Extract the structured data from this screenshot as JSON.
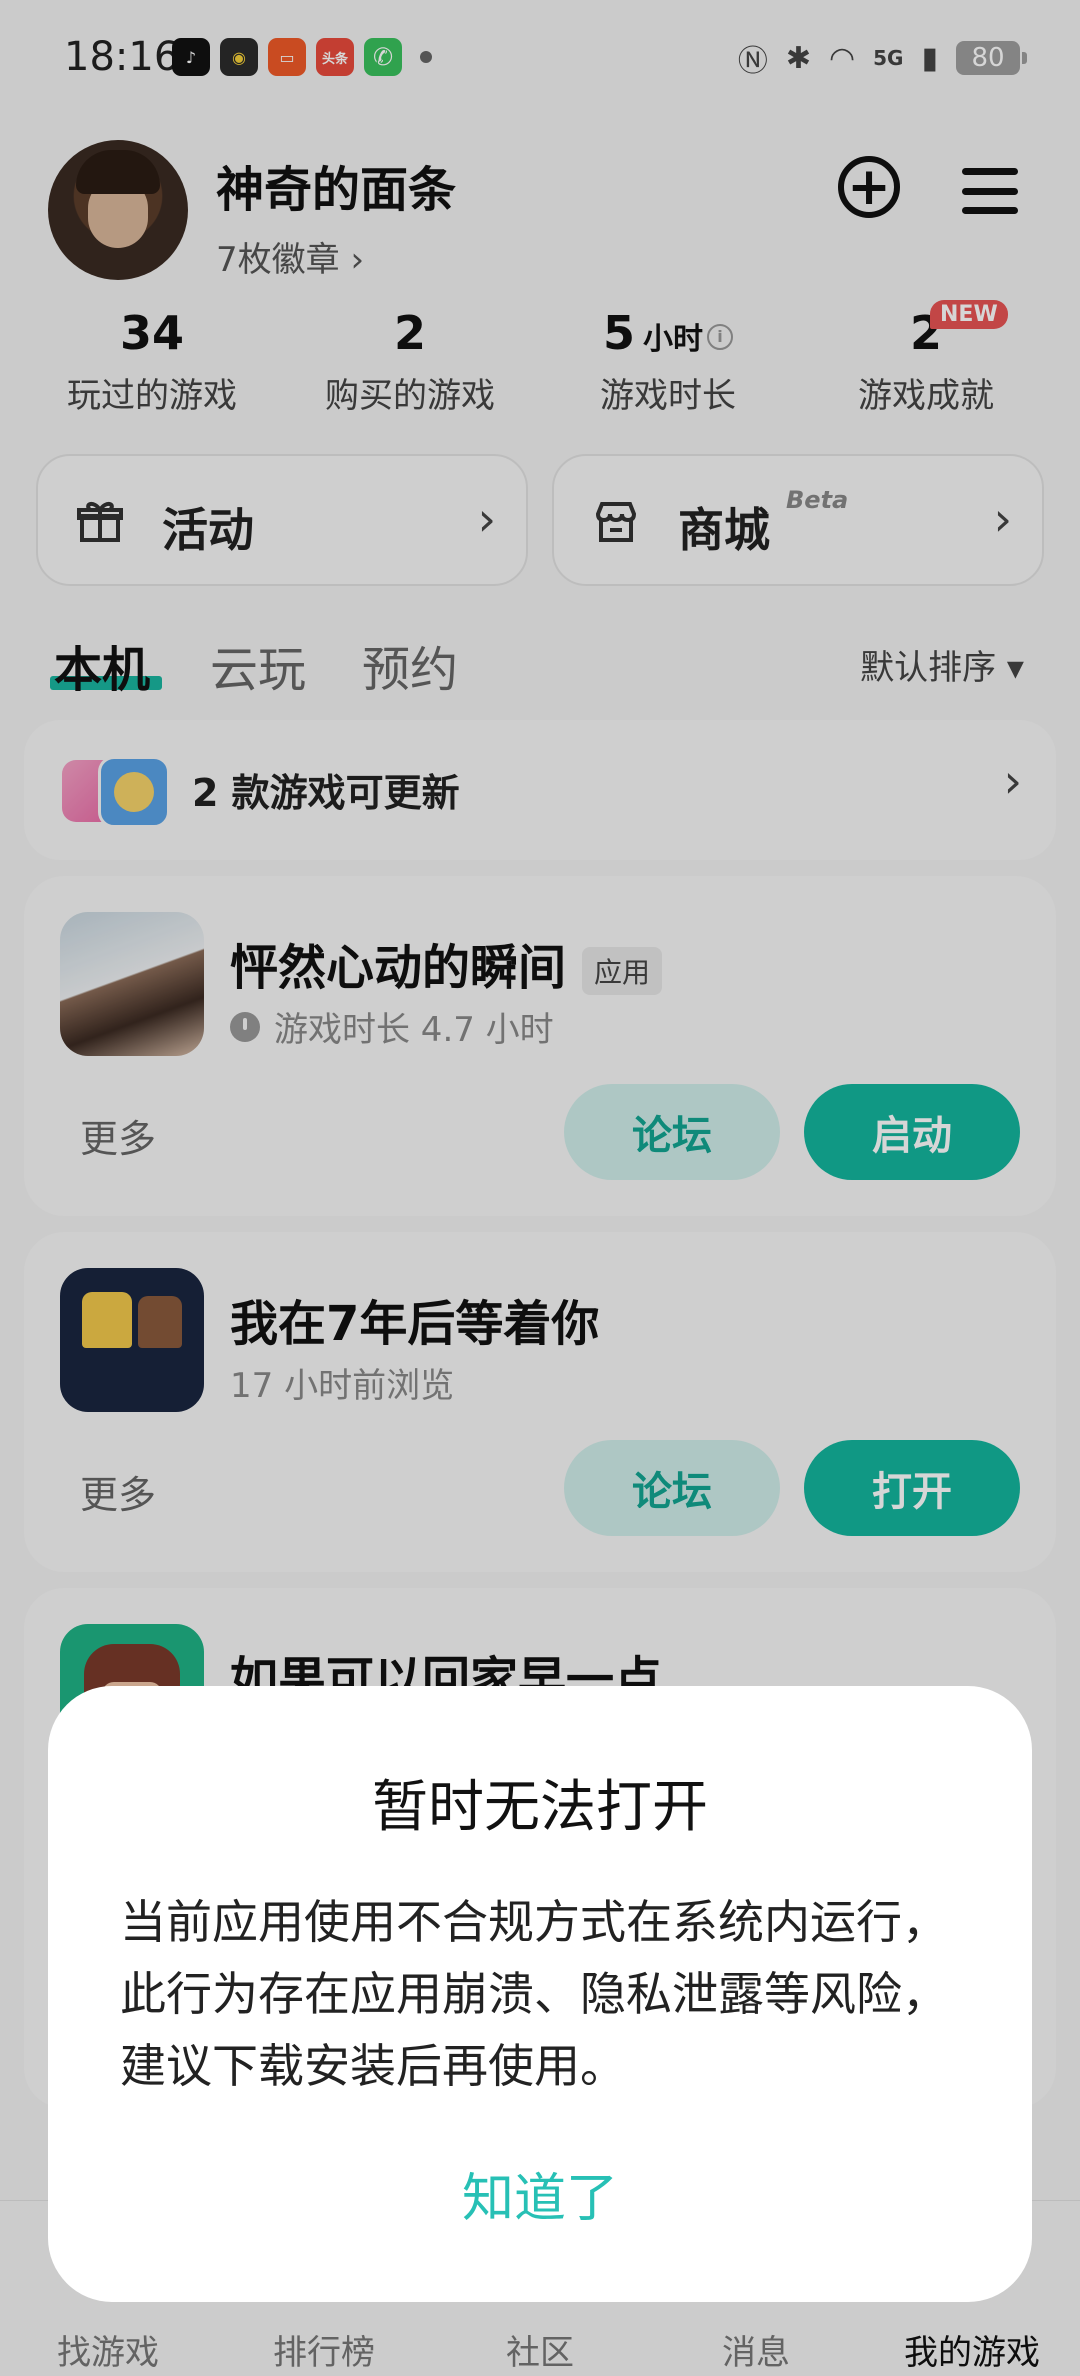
{
  "status_bar": {
    "time": "18:16",
    "battery": "80",
    "network": "5G",
    "app_icons": [
      {
        "name": "douyin",
        "text": "♪",
        "color": "#111111"
      },
      {
        "name": "app-yellow",
        "text": "◉",
        "color": "#2b2b2b"
      },
      {
        "name": "app-orange",
        "text": "▭",
        "color": "#f05a28"
      },
      {
        "name": "toutiao",
        "text": "头条",
        "color": "#e94b3c"
      },
      {
        "name": "phone",
        "text": "✆",
        "color": "#3ac25e"
      }
    ]
  },
  "profile": {
    "username": "神奇的面条",
    "badges": "7枚徽章 ›"
  },
  "stats": [
    {
      "value": "34",
      "unit": "",
      "label": "玩过的游戏"
    },
    {
      "value": "2",
      "unit": "",
      "label": "购买的游戏"
    },
    {
      "value": "5",
      "unit": "小时",
      "label": "游戏时长"
    },
    {
      "value": "2",
      "unit": "",
      "label": "游戏成就"
    }
  ],
  "new_badge": "NEW",
  "quick_cards": {
    "activity": "活动",
    "store": "商城",
    "store_beta": "Beta"
  },
  "tabs": [
    "本机",
    "云玩",
    "预约"
  ],
  "sort": "默认排序 ▾",
  "update_row": {
    "text": "2 款游戏可更新"
  },
  "games": [
    {
      "title": "怦然心动的瞬间",
      "tag": "应用",
      "subtitle": "游戏时长 4.7 小时",
      "more": "更多",
      "forum": "论坛",
      "action": "启动"
    },
    {
      "title": "我在7年后等着你",
      "tag": "",
      "subtitle": "17 小时前浏览",
      "more": "更多",
      "forum": "论坛",
      "action": "打开"
    },
    {
      "title": "如果可以回家早一点"
    }
  ],
  "bottom_nav": [
    "找游戏",
    "排行榜",
    "社区",
    "消息",
    "我的游戏"
  ],
  "dialog": {
    "title": "暂时无法打开",
    "body": "当前应用使用不合规方式在系统内运行，此行为存在应用崩溃、隐私泄露等风险，建议下载安装后再使用。",
    "ok": "知道了"
  },
  "colors": {
    "accent": "#14b59e",
    "accent_light": "#d0eeea",
    "dialog_button": "#27c0b5",
    "new_badge": "#e85454"
  }
}
